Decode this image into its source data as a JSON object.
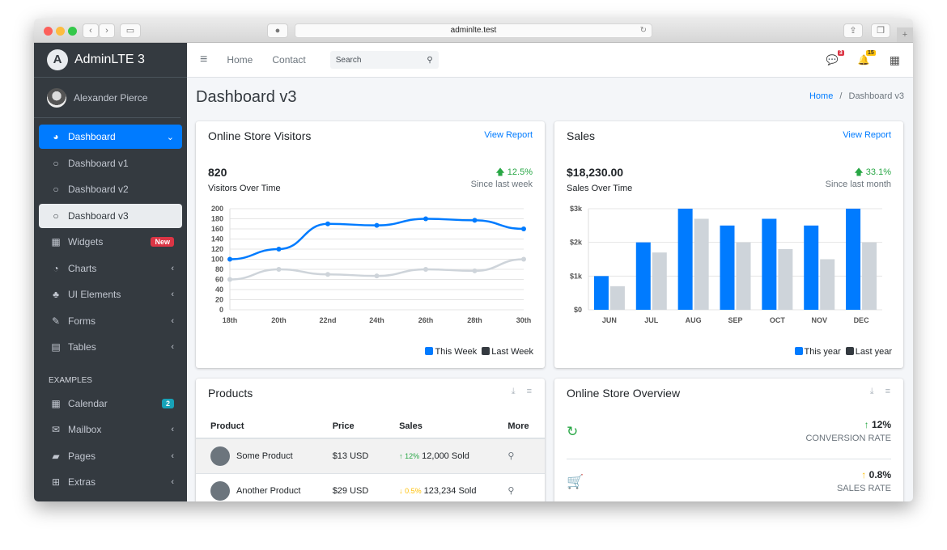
{
  "browser": {
    "url": "adminlte.test",
    "back": "‹",
    "forward": "›",
    "new_tab": "+"
  },
  "sidebar": {
    "brand": "AdminLTE 3",
    "brand_logo": "A",
    "user": "Alexander Pierce",
    "items": [
      {
        "label": "Dashboard",
        "icon": "◕",
        "right": "⌄",
        "state": "active"
      },
      {
        "label": "Dashboard v1",
        "icon": "○",
        "right": "",
        "state": "sub"
      },
      {
        "label": "Dashboard v2",
        "icon": "○",
        "right": "",
        "state": "sub"
      },
      {
        "label": "Dashboard v3",
        "icon": "○",
        "right": "",
        "state": "current"
      },
      {
        "label": "Widgets",
        "icon": "▦",
        "badge": "New",
        "badge_color": "#dc3545"
      },
      {
        "label": "Charts",
        "icon": "◔",
        "right": "‹"
      },
      {
        "label": "UI Elements",
        "icon": "♣",
        "right": "‹"
      },
      {
        "label": "Forms",
        "icon": "✎",
        "right": "‹"
      },
      {
        "label": "Tables",
        "icon": "▤",
        "right": "‹"
      }
    ],
    "section_header": "EXAMPLES",
    "examples": [
      {
        "label": "Calendar",
        "icon": "▦",
        "badge": "2",
        "badge_color": "#17a2b8"
      },
      {
        "label": "Mailbox",
        "icon": "✉",
        "right": "‹"
      },
      {
        "label": "Pages",
        "icon": "▰",
        "right": "‹"
      },
      {
        "label": "Extras",
        "icon": "⊞",
        "right": "‹"
      }
    ]
  },
  "navbar": {
    "menu_icon": "≡",
    "home": "Home",
    "contact": "Contact",
    "search_placeholder": "Search",
    "messages_count": "3",
    "notifications_count": "15"
  },
  "page": {
    "title": "Dashboard v3",
    "breadcrumb_home": "Home",
    "breadcrumb_sep": "/",
    "breadcrumb_current": "Dashboard v3"
  },
  "visitors": {
    "title": "Online Store Visitors",
    "link": "View Report",
    "value": "820",
    "subtitle": "Visitors Over Time",
    "pct": "12.5%",
    "since": "Since last week"
  },
  "sales": {
    "title": "Sales",
    "link": "View Report",
    "value": "$18,230.00",
    "subtitle": "Sales Over Time",
    "pct": "33.1%",
    "since": "Since last month"
  },
  "chart_data": [
    {
      "type": "line",
      "title": "Online Store Visitors",
      "categories": [
        "18th",
        "20th",
        "22nd",
        "24th",
        "26th",
        "28th",
        "30th"
      ],
      "series": [
        {
          "name": "This Week",
          "color": "#007bff",
          "values": [
            100,
            120,
            170,
            167,
            180,
            177,
            160
          ]
        },
        {
          "name": "Last Week",
          "color": "#ced4da",
          "values": [
            60,
            80,
            70,
            67,
            80,
            77,
            100
          ]
        }
      ],
      "ylim": [
        0,
        200
      ],
      "yticks": [
        0,
        20,
        40,
        60,
        80,
        100,
        120,
        140,
        160,
        180,
        200
      ],
      "legend": [
        "This Week",
        "Last Week"
      ],
      "legend_position": "bottom-right",
      "grid": true
    },
    {
      "type": "bar",
      "title": "Sales",
      "categories": [
        "JUN",
        "JUL",
        "AUG",
        "SEP",
        "OCT",
        "NOV",
        "DEC"
      ],
      "series": [
        {
          "name": "This year",
          "color": "#007bff",
          "values": [
            1000,
            2000,
            3000,
            2500,
            2700,
            2500,
            3000
          ]
        },
        {
          "name": "Last year",
          "color": "#ced4da",
          "values": [
            700,
            1700,
            2700,
            2000,
            1800,
            1500,
            2000
          ]
        }
      ],
      "ylim": [
        0,
        3000
      ],
      "yticks": [
        "$0",
        "$1k",
        "$2k",
        "$3k"
      ],
      "legend": [
        "This year",
        "Last year"
      ],
      "legend_position": "bottom-right",
      "grid": true
    }
  ],
  "products": {
    "title": "Products",
    "columns": [
      "Product",
      "Price",
      "Sales",
      "More"
    ],
    "rows": [
      {
        "name": "Some Product",
        "price": "$13 USD",
        "trend": "↑",
        "pct": "12%",
        "pct_color": "#28a745",
        "sold": "12,000 Sold"
      },
      {
        "name": "Another Product",
        "price": "$29 USD",
        "trend": "↓",
        "pct": "0.5%",
        "pct_color": "#ffc107",
        "sold": "123,234 Sold"
      }
    ]
  },
  "overview": {
    "title": "Online Store Overview",
    "rows": [
      {
        "icon": "↻",
        "icon_color": "#28a745",
        "arrow": "↑",
        "value": "12%",
        "label": "CONVERSION RATE"
      },
      {
        "icon": "🛒",
        "icon_color": "#ffc107",
        "arrow": "↑",
        "value": "0.8%",
        "label": "SALES RATE"
      }
    ]
  }
}
